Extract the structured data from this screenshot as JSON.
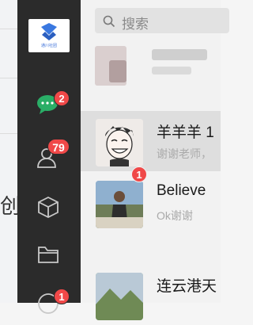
{
  "sidebar": {
    "logo_text": "通川社团",
    "chat_badge": "2",
    "contacts_badge": "79",
    "bottom_badge": "1"
  },
  "search": {
    "placeholder": "搜索"
  },
  "chats": [
    {
      "name": "羊羊羊 1",
      "message": "谢谢老师，"
    },
    {
      "name": "Believe",
      "message": "Ok谢谢",
      "badge": "1"
    },
    {
      "name": "连云港天",
      "message": ""
    }
  ],
  "background": {
    "glyph": "创"
  },
  "colors": {
    "sidebar": "#2b2b2b",
    "badge": "#f04848",
    "chat_icon": "#2aae67"
  }
}
